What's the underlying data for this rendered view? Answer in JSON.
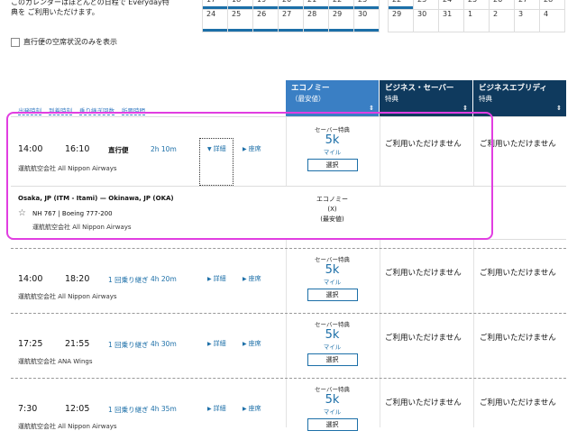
{
  "info": {
    "calendar_text": "このカレンダーはほとんどの日程で Everyday特典を ご利用いただけます。",
    "nonstop_label": "直行便の空席状況のみを表示"
  },
  "calendar": {
    "left": [
      [
        "17",
        "18",
        "19",
        "20",
        "21",
        "22",
        "23"
      ],
      [
        "24",
        "25",
        "26",
        "27",
        "28",
        "29",
        "30"
      ]
    ],
    "right": [
      [
        "22",
        "23",
        "24",
        "25",
        "26",
        "27",
        "28"
      ],
      [
        "29",
        "30",
        "31",
        "1",
        "2",
        "3",
        "4"
      ]
    ]
  },
  "column_headers": {
    "departure": "出発時刻",
    "arrival": "到着時刻",
    "connections": "乗り継ぎ回数",
    "duration": "所要時間"
  },
  "fare_columns": [
    {
      "title": "エコノミー",
      "sub": "（最安値）"
    },
    {
      "title": "ビジネス・セーバー",
      "sub": "特典"
    },
    {
      "title": "ビジネスエブリディ",
      "sub": "特典"
    }
  ],
  "flights": [
    {
      "dep": "14:00",
      "arr": "16:10",
      "stops": "直行便",
      "duration": "2h 10m",
      "details": "詳細",
      "seat": "座席",
      "carrier": "運航航空会社 All Nippon Airways",
      "award_type": "セーバー特典",
      "miles": "5k",
      "miles_unit": "マイル",
      "select": "選択",
      "na1": "ご利用いただけません",
      "na2": "ご利用いただけません"
    },
    {
      "dep": "14:00",
      "arr": "18:20",
      "stops": "1 回乗り継ぎ",
      "duration": "4h 20m",
      "details": "詳細",
      "seat": "座席",
      "carrier": "運航航空会社 All Nippon Airways",
      "award_type": "セーバー特典",
      "miles": "5k",
      "miles_unit": "マイル",
      "select": "選択",
      "na1": "ご利用いただけません",
      "na2": "ご利用いただけません"
    },
    {
      "dep": "17:25",
      "arr": "21:55",
      "stops": "1 回乗り継ぎ",
      "duration": "4h 30m",
      "details": "詳細",
      "seat": "座席",
      "carrier": "運航航空会社 ANA Wings",
      "award_type": "セーバー特典",
      "miles": "5k",
      "miles_unit": "マイル",
      "select": "選択",
      "na1": "ご利用いただけません",
      "na2": "ご利用いただけません"
    },
    {
      "dep": "7:30",
      "arr": "12:05",
      "stops": "1 回乗り継ぎ",
      "duration": "4h 35m",
      "details": "詳細",
      "seat": "座席",
      "carrier": "運航航空会社 All Nippon Airways",
      "award_type": "セーバー特典",
      "miles": "5k",
      "miles_unit": "マイル",
      "select": "選択",
      "na1": "ご利用いただけません",
      "na2": "ご利用いただけません"
    }
  ],
  "segment_detail": {
    "route": "Osaka, JP (ITM - Itami) — Okinawa, JP (OKA)",
    "flight": "NH 767  |  Boeing 777-200",
    "operator": "運航航空会社 All Nippon Airways",
    "class_line1": "エコノミー",
    "class_line2": "(X)",
    "class_line3": "(最安値)"
  },
  "colors": {
    "accent": "#3a7fc4",
    "navy": "#0f3a5e",
    "highlight": "#e13ee1"
  }
}
